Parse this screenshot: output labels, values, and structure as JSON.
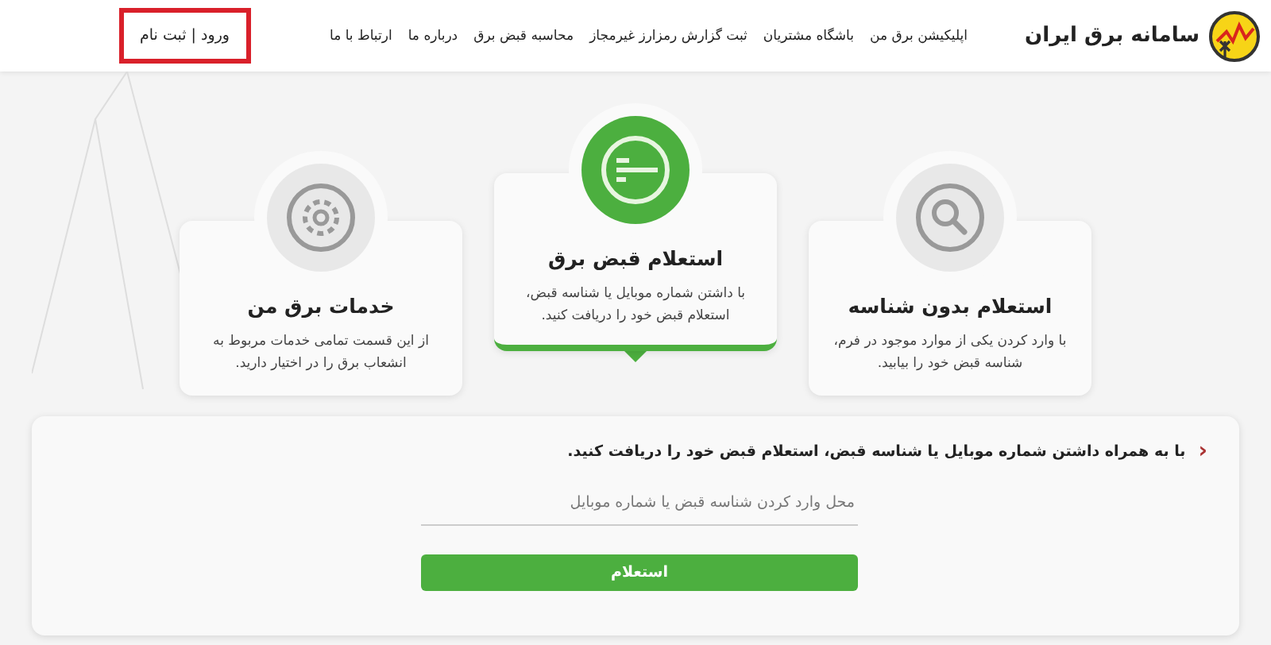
{
  "header": {
    "logo_text": "سامانه برق ایران",
    "nav": [
      "اپلیکیشن برق من",
      "باشگاه مشتریان",
      "ثبت گزارش رمزارز غیرمجاز",
      "محاسبه قبض برق",
      "درباره ما",
      "ارتباط با ما"
    ],
    "login": "ورود | ثبت نام"
  },
  "cards": [
    {
      "kind": "search",
      "title": "استعلام بدون شناسه",
      "text": "با وارد کردن یکی از موارد موجود در فرم، شناسه قبض خود را بیابید.",
      "selected": false
    },
    {
      "kind": "bill",
      "title": "استعلام قبض برق",
      "text": "با داشتن شماره موبایل یا شناسه قبض، استعلام قبض خود را دریافت کنید.",
      "selected": true
    },
    {
      "kind": "gear",
      "title": "خدمات برق من",
      "text": "از این قسمت تمامی خدمات مربوط به انشعاب برق را در اختیار دارید.",
      "selected": false
    }
  ],
  "form": {
    "caret": "‹",
    "instruction": "با به همراه داشتن شماره موبایل یا شناسه قبض، استعلام قبض خود را دریافت کنید.",
    "placeholder": "محل وارد کردن شناسه قبض یا شماره موبایل",
    "button": "استعلام"
  }
}
